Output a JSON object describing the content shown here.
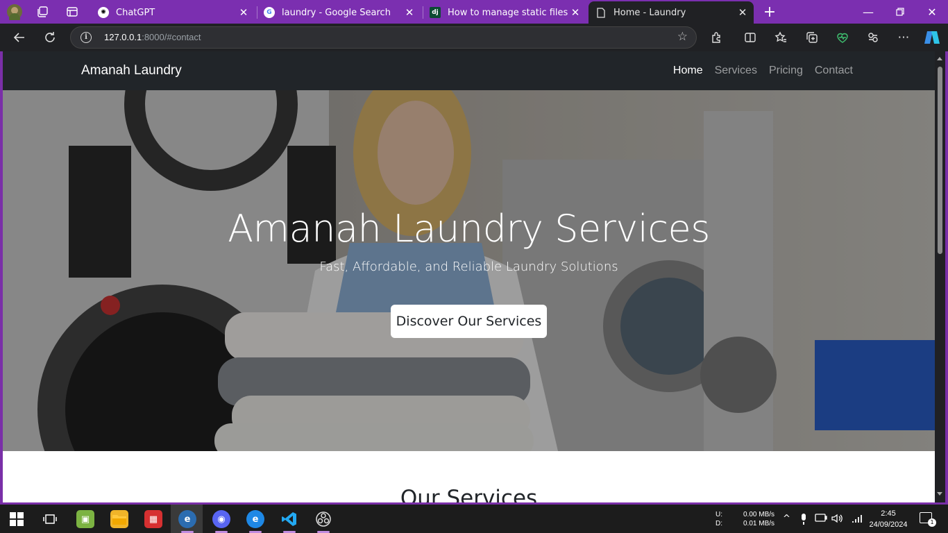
{
  "browser": {
    "tabs": [
      {
        "label": "ChatGPT",
        "icon": "chatgpt-icon"
      },
      {
        "label": "laundry - Google Search",
        "icon": "google-icon"
      },
      {
        "label": "How to manage static files (e.g. im",
        "icon": "django-icon"
      },
      {
        "label": "Home - Laundry",
        "icon": "page-icon"
      }
    ],
    "url_host": "127.0.0.1",
    "url_rest": ":8000/#contact"
  },
  "site": {
    "brand": "Amanah Laundry",
    "nav": [
      "Home",
      "Services",
      "Pricing",
      "Contact"
    ],
    "hero_title": "Amanah Laundry Services",
    "hero_subtitle": "Fast, Affordable, and Reliable Laundry Solutions",
    "hero_button": "Discover Our Services",
    "section_title": "Our Services"
  },
  "taskbar": {
    "net_up_label": "U:",
    "net_down_label": "D:",
    "net_up": "0.00 MB/s",
    "net_down": "0.01 MB/s",
    "time": "2:45",
    "date": "24/09/2024",
    "notifications": "1"
  },
  "colors": {
    "tabbar": "#7b2fb0",
    "navbar": "#212529",
    "accent": "#c08be0"
  }
}
